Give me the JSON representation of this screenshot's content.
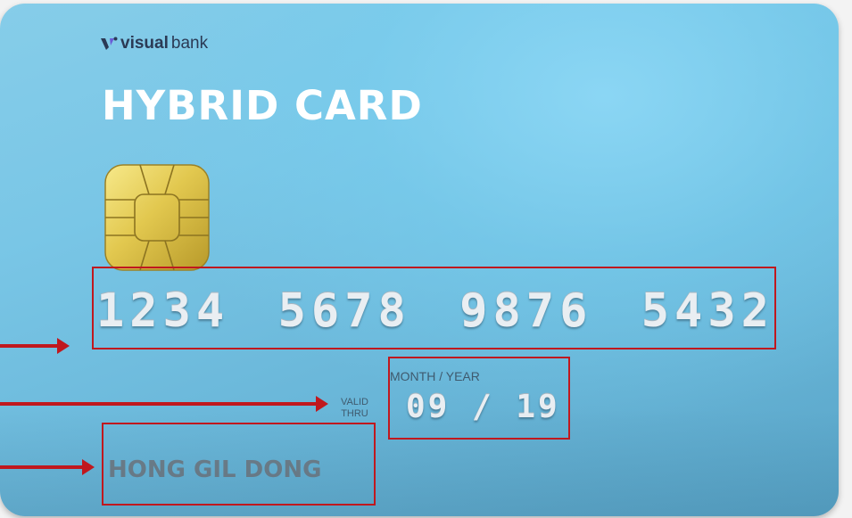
{
  "brand": {
    "logo_icon": "v-logo-icon",
    "name_bold": "visual",
    "name_light": "bank",
    "logo_color": "#2b3a55"
  },
  "card": {
    "title": "HYBRID CARD",
    "number_groups": [
      "1234",
      "5678",
      "9876",
      "5432"
    ],
    "valid_label_line1": "VALID",
    "valid_label_line2": "THRU",
    "expiry_caption": "MONTH / YEAR",
    "expiry": "09 / 19",
    "holder_name": "HONG GIL DONG",
    "chip_icon": "emv-chip-icon",
    "background_color": "#79c6e6"
  },
  "annotations": {
    "highlight_color": "#c0181e",
    "arrow_icon": "arrow-right-icon"
  }
}
